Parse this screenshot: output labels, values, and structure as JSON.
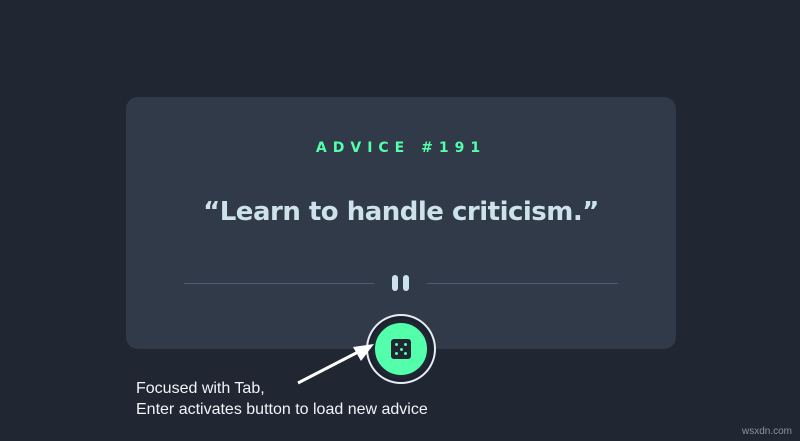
{
  "card": {
    "advice_label": "ADVICE #191",
    "quote": "“Learn to handle criticism.”"
  },
  "divider": {
    "icon": "pause-icon"
  },
  "button": {
    "icon": "dice-icon",
    "state": "focused"
  },
  "annotation": {
    "line1": "Focused with Tab,",
    "line2": "Enter activates button to load new advice"
  },
  "watermark": "wsxdn.com",
  "colors": {
    "background": "#202632",
    "card": "#313a48",
    "accent": "#53ffaa",
    "text": "#cee3e9",
    "divider": "#4f5d74"
  }
}
